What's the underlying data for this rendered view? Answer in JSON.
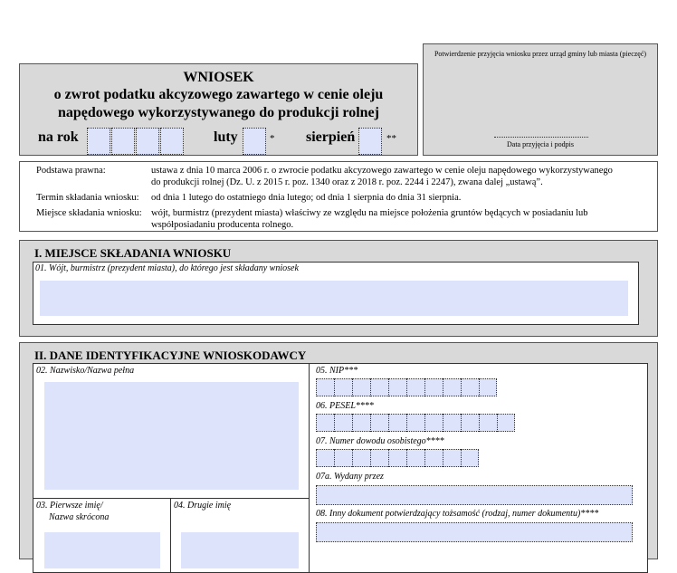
{
  "header": {
    "title": "WNIOSEK",
    "subtitle_line1": "o zwrot podatku akcyzowego zawartego w cenie oleju",
    "subtitle_line2": "napędowego wykorzystywanego do produkcji rolnej",
    "year_label": "na rok",
    "february_label": "luty",
    "february_mark": "*",
    "august_label": "sierpień",
    "august_mark": "**"
  },
  "stamp": {
    "text": "Potwierdzenie przyjęcia wniosku przez urząd gminy lub miasta (pieczęć)",
    "date_label": "Data przyjęcia i podpis"
  },
  "legal": {
    "basis_label": "Podstawa prawna:",
    "basis_text_line1": "ustawa z dnia 10 marca 2006 r. o zwrocie podatku akcyzowego zawartego w cenie oleju  napędowego wykorzystywanego",
    "basis_text_line2": "do produkcji  rolnej (Dz. U. z 2015 r. poz. 1340 oraz z 2018 r. poz. 2244 i 2247), zwana dalej „ustawą”.",
    "deadline_label": "Termin składania wniosku:",
    "deadline_text": "od dnia 1 lutego do ostatniego dnia lutego; od dnia 1 sierpnia do dnia 31 sierpnia.",
    "place_label": "Miejsce składania wniosku:",
    "place_text_line1": "wójt, burmistrz (prezydent miasta) właściwy ze względu na miejsce położenia gruntów będących w posiadaniu lub",
    "place_text_line2": "współposiadaniu producenta rolnego."
  },
  "section1": {
    "title": "I. MIEJSCE SKŁADANIA WNIOSKU",
    "field01_label": "01. Wójt, burmistrz (prezydent miasta), do którego jest składany wniosek"
  },
  "section2": {
    "title": "II. DANE IDENTYFIKACYJNE WNIOSKODAWCY",
    "field02_label": "02. Nazwisko/Nazwa pełna",
    "field03_label_line1": "03. Pierwsze imię/",
    "field03_label_line2": "Nazwa skrócona",
    "field04_label": "04. Drugie imię",
    "field05_label": "05. NIP***",
    "field06_label": "06. PESEL****",
    "field07_label": "07. Numer dowodu osobistego****",
    "field07a_label": "07a. Wydany przez",
    "field08_label": "08. Inny dokument potwierdzający tożsamość (rodzaj, numer dokumentu)****"
  }
}
